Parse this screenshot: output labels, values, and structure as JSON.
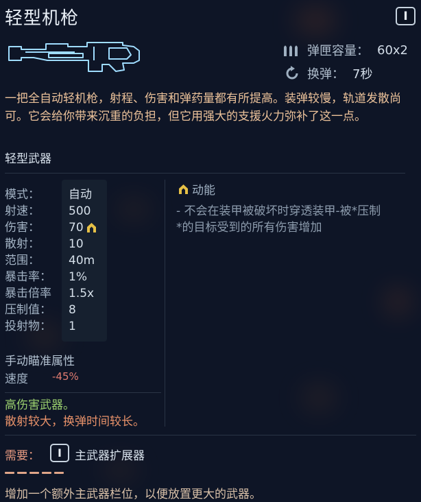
{
  "weapon": {
    "title": "轻型机枪",
    "tier": "I",
    "magazine_label": "弹匣容量：",
    "magazine_value": "60x2",
    "reload_label": "换弹：",
    "reload_value": "7秒",
    "description": "一把全自动轻机枪，射程、伤害和弹药量都有所提高。装弹较慢，轨道发散尚可。它会给你带来沉重的负担，但它用强大的支援火力弥补了这一点。",
    "category": "轻型武器"
  },
  "stats": [
    {
      "label": "模式：",
      "value": "自动"
    },
    {
      "label": "射速：",
      "value": "500"
    },
    {
      "label": "伤害：",
      "value": "70"
    },
    {
      "label": "散射：",
      "value": "10"
    },
    {
      "label": "范围：",
      "value": "40m"
    },
    {
      "label": "暴击率：",
      "value": "1%"
    },
    {
      "label": "暴击倍率",
      "value": "1.5x"
    },
    {
      "label": "压制值：",
      "value": "8"
    },
    {
      "label": "投射物：",
      "value": "1"
    }
  ],
  "perk": {
    "title": "动能",
    "description": "- 不会在装甲被破坏时穿透装甲-被*压制*的目标受到的所有伤害增加"
  },
  "aim": {
    "title": "手动瞄准属性",
    "label": "速度",
    "value": "-45%"
  },
  "traits": {
    "good": "高伤害武器。",
    "bad": "散射较大，换弹时间较长。"
  },
  "requirement": {
    "label": "需要：",
    "tier": "I",
    "item": "主武器扩展器",
    "description": "增加一个额外主武器栏位，以便放置更大的武器。"
  },
  "colors": {
    "background": "#0e1526",
    "description": "#ecc29a",
    "good": "#9bd06e",
    "bad": "#e8926a",
    "negative_value": "#e07b70",
    "gun_outline": "#9fdcff"
  },
  "icons": {
    "ammo": "ammo-bullets-icon",
    "reload": "reload-arrow-icon",
    "kinetic": "kinetic-chevron-icon"
  }
}
